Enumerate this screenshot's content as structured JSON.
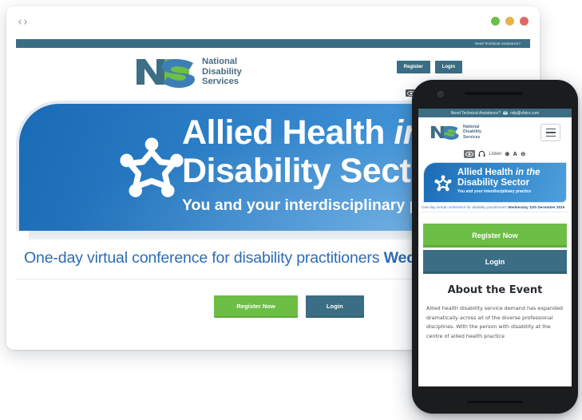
{
  "browser": {
    "nav_back": "‹",
    "nav_forward": "›",
    "window_dots": [
      {
        "name": "minimize",
        "color": "#6cbe45"
      },
      {
        "name": "maximize",
        "color": "#e8b34b"
      },
      {
        "name": "close",
        "color": "#e06a63"
      }
    ]
  },
  "desktop": {
    "top_strip": {
      "assistance_text": "Need Technical Assistance?"
    },
    "logo": {
      "letters": "NDS",
      "line1": "National",
      "line2": "Disability",
      "line3": "Services",
      "colors": {
        "n": "#3d6e86",
        "d": "#6cbe45",
        "s": "#3d7fb5",
        "words": "#4a6b80"
      }
    },
    "header_buttons": [
      {
        "label": "Register"
      },
      {
        "label": "Login"
      }
    ],
    "accessibility": {
      "eye_icon": "eye-icon",
      "headphones_icon": "headphones-icon"
    },
    "hero": {
      "title_part1": "Allied Health ",
      "title_italic": "in",
      "title_line2": "Disability Sect",
      "subtitle": "You and your interdisciplinary p",
      "logo_icon": "people-circle-icon"
    },
    "conference_line": {
      "text": "One-day virtual conference for disability practitioners ",
      "bold": "Wednesday"
    },
    "cta": [
      {
        "label": "Register Now",
        "style": "green"
      },
      {
        "label": "Login",
        "style": "teal"
      }
    ]
  },
  "phone": {
    "top_strip": {
      "assistance_text": "Need Technical Assistance?",
      "mail_icon": "mail-icon",
      "email": "ndp@vfairs.com"
    },
    "logo": {
      "letters": "NDS",
      "line1": "National",
      "line2": "Disability",
      "line3": "Services"
    },
    "menu_icon": "hamburger-menu-icon",
    "accessibility": {
      "eye_icon": "eye-icon",
      "headphones_icon": "headphones-icon",
      "listen_label": "Listen",
      "increase_label": "⊕",
      "font_label": "A",
      "decrease_label": "⊖"
    },
    "hero": {
      "title_line1": "Allied Health ",
      "title_italic": "in the",
      "title_line2": "Disability Sector",
      "subtitle": "You and your interdisciplinary practice",
      "logo_icon": "people-circle-icon"
    },
    "conference_line": {
      "text": "One-day virtual conference for disability practitioners ",
      "bold": "Wednesday 11th December 2019"
    },
    "cta": [
      {
        "label": "Register Now",
        "style": "green"
      },
      {
        "label": "Login",
        "style": "teal"
      }
    ],
    "about": {
      "heading": "About the Event",
      "paragraph": "Allied health disability service demand has expanded dramatically across all of the diverse professional disciplines. With the person with disability at the centre of allied health practice"
    }
  },
  "theme": {
    "teal": "#3b6e84",
    "green": "#6cbe45",
    "blue": "#2d6cb5",
    "hero_blue_dark": "#1a6ab5",
    "hero_blue_light": "#56a6e2",
    "phone_body": "#1b1c1e"
  }
}
